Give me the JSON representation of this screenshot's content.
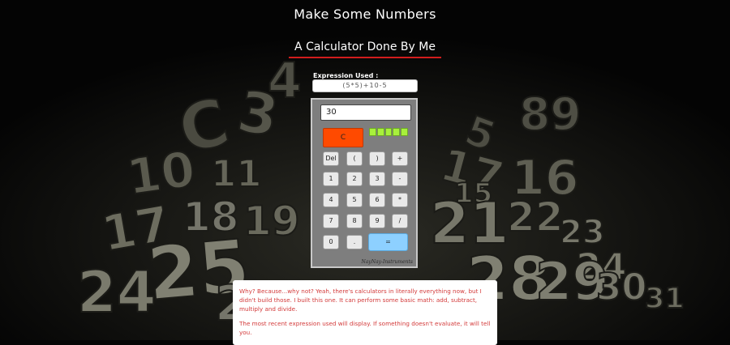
{
  "header": {
    "title": "Make Some Numbers",
    "subtitle": "A Calculator Done By Me"
  },
  "expression": {
    "label": "Expression Used :",
    "value": "(5*5)+10-5"
  },
  "calculator": {
    "display": "30",
    "clear_label": "C",
    "keys": [
      {
        "label": "Del"
      },
      {
        "label": "("
      },
      {
        "label": ")"
      },
      {
        "label": "+"
      },
      {
        "label": "1"
      },
      {
        "label": "2"
      },
      {
        "label": "3"
      },
      {
        "label": "-"
      },
      {
        "label": "4"
      },
      {
        "label": "5"
      },
      {
        "label": "6"
      },
      {
        "label": "*"
      },
      {
        "label": "7"
      },
      {
        "label": "8"
      },
      {
        "label": "9"
      },
      {
        "label": "/"
      },
      {
        "label": "0"
      },
      {
        "label": "."
      }
    ],
    "equals_label": "=",
    "brand": "NayNay-Instruments",
    "colors": {
      "body": "#7e7e7e",
      "clear": "#ff4a00",
      "meter": "#a8f03c",
      "equals": "#8dd0ff",
      "accent_rule": "#d21d1d"
    }
  },
  "info": {
    "para1": "Why? Because...why not? Yeah, there's calculators in literally everything now, but I didn't build those. I built this one. It can perform some basic math: add, subtract, multiply and divide.",
    "para2": "The most recent expression used will display. If something doesn't evaluate, it will tell you."
  }
}
